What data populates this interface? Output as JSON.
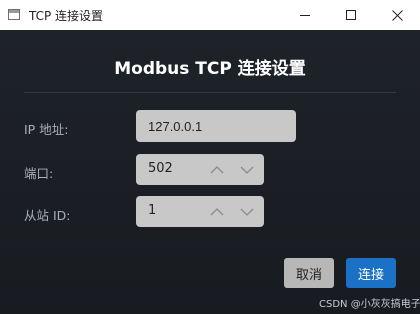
{
  "window": {
    "title": "TCP 连接设置",
    "controls": {
      "minimize": "minimize-icon",
      "maximize": "maximize-icon",
      "close": "close-icon"
    }
  },
  "dialog": {
    "heading": "Modbus TCP 连接设置",
    "fields": {
      "ip": {
        "label": "IP 地址:",
        "value": "127.0.0.1"
      },
      "port": {
        "label": "端口:",
        "value": "502"
      },
      "slave_id": {
        "label": "从站 ID:",
        "value": "1"
      }
    },
    "buttons": {
      "cancel": "取消",
      "connect": "连接"
    }
  },
  "watermark": "CSDN @小灰灰搞电子",
  "colors": {
    "background": "#1b1f24",
    "accent": "#1a71c5",
    "field_bg": "#c8c8c8",
    "cancel_bg": "#b7b7b7"
  }
}
